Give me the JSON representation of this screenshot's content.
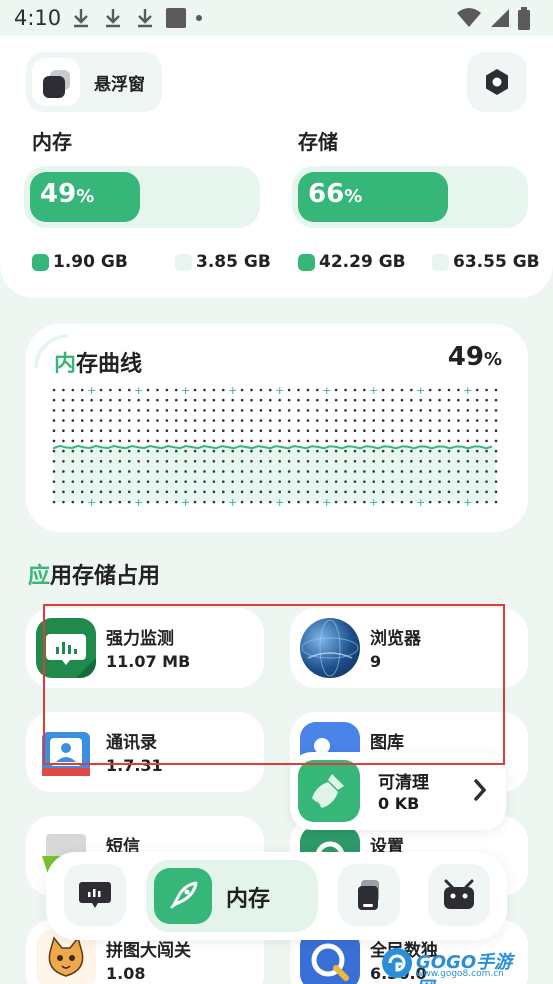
{
  "status_bar": {
    "time": "4:10"
  },
  "header": {
    "float_window_label": "悬浮窗"
  },
  "memory": {
    "title": "内存",
    "percent": "49",
    "percent_unit": "%",
    "fill_fraction": 0.49,
    "used": "1.90 GB",
    "total": "3.85 GB"
  },
  "storage": {
    "title": "存储",
    "percent": "66",
    "percent_unit": "%",
    "fill_fraction": 0.66,
    "used": "42.29 GB",
    "total": "63.55 GB"
  },
  "curve": {
    "title_accent": "内",
    "title_rest": "存曲线",
    "percent": "49",
    "percent_unit": "%"
  },
  "apps_section": {
    "title_accent": "应",
    "title_rest": "用存储占用"
  },
  "apps": [
    {
      "name": "强力监测",
      "size": "11.07 MB"
    },
    {
      "name": "浏览器",
      "size": "9"
    },
    {
      "name": "通讯录",
      "size": "1.7.31"
    },
    {
      "name": "图库",
      "size": ""
    },
    {
      "name": "短信",
      "size": ""
    },
    {
      "name": "设置",
      "size": ""
    },
    {
      "name": "拼图大闯关",
      "size": "1.08"
    },
    {
      "name": "全民数独",
      "size": "6.30.0"
    }
  ],
  "cleanable": {
    "title": "可清理",
    "value": "0 KB"
  },
  "bottom_nav": {
    "active_label": "内存"
  },
  "watermark": {
    "text": "GOGO手游网",
    "sub": "www.gogo8.com.cn"
  },
  "colors": {
    "accent": "#36b679",
    "accent_light": "#e6f6ee",
    "background": "#eef6f2",
    "highlight": "#e23b3b"
  }
}
